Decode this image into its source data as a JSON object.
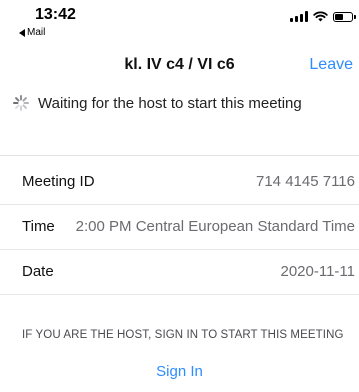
{
  "status_bar": {
    "time": "13:42",
    "back_app": "Mail",
    "icons": [
      "signal-icon",
      "wifi-icon",
      "battery-icon"
    ]
  },
  "nav": {
    "title": "kl. IV c4 / VI c6",
    "leave_label": "Leave"
  },
  "waiting": {
    "text": "Waiting for the host to start this meeting",
    "icon": "spinner-icon"
  },
  "details": {
    "meeting_id_label": "Meeting ID",
    "meeting_id_value": "714 4145 7116",
    "time_label": "Time",
    "time_value": "2:00 PM Central European Standard Time",
    "date_label": "Date",
    "date_value": "2020-11-11"
  },
  "host_note": "IF YOU ARE THE HOST, SIGN IN TO START THIS MEETING",
  "sign_in_label": "Sign In",
  "colors": {
    "accent": "#2d8cff",
    "text": "#111111",
    "muted": "#6b6b70",
    "divider": "#e7e7ea"
  }
}
